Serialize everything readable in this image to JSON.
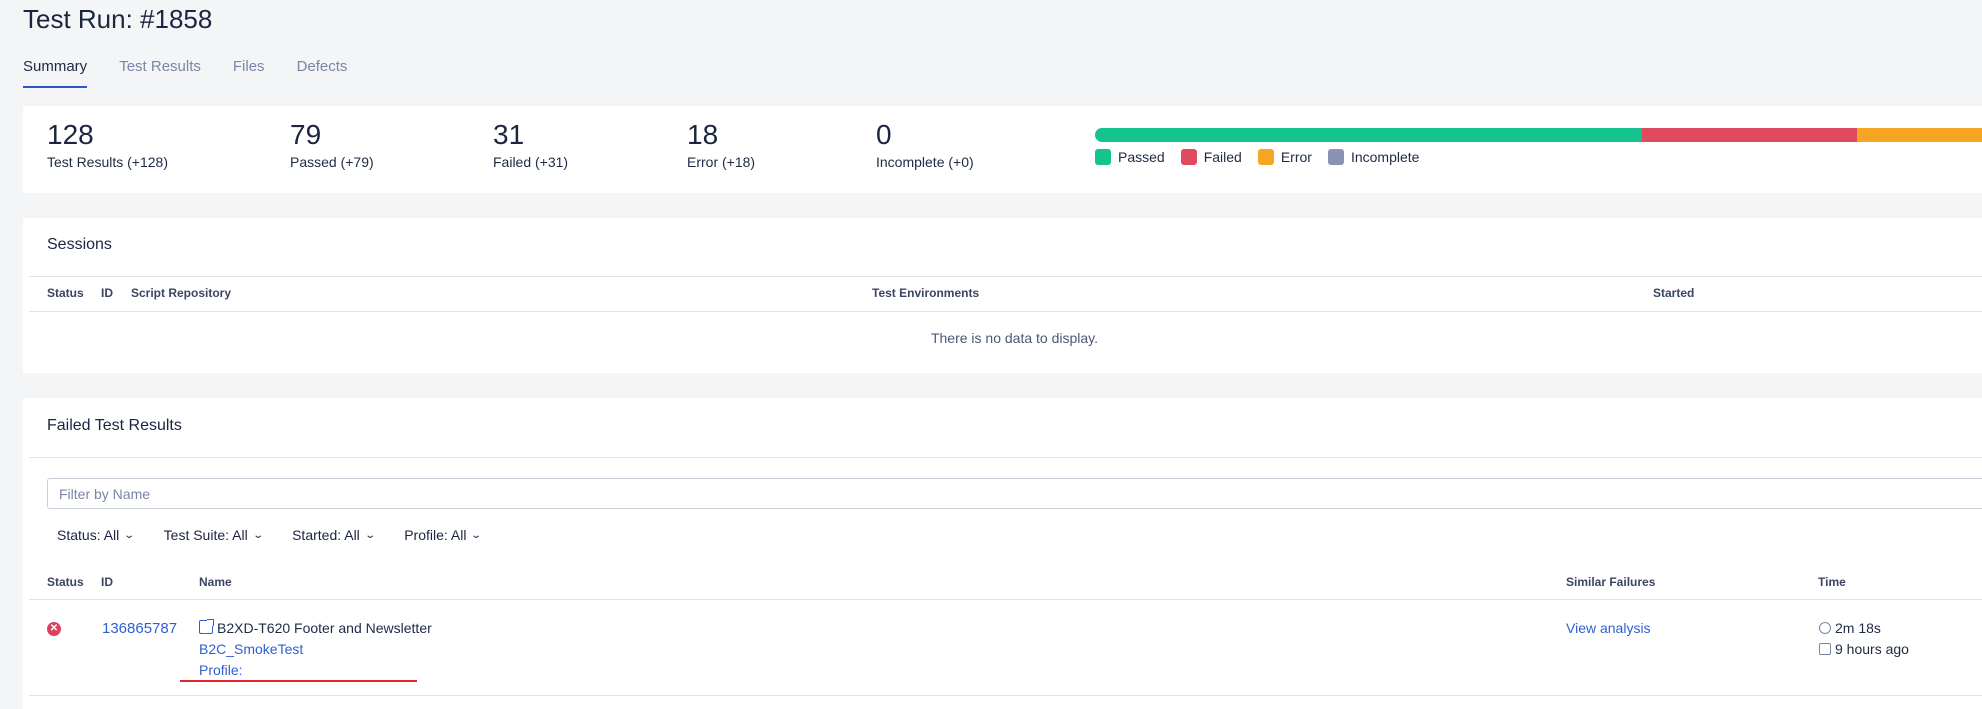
{
  "page": {
    "title": "Test Run: #1858"
  },
  "tabs": [
    "Summary",
    "Test Results",
    "Files",
    "Defects"
  ],
  "summary": {
    "stats": [
      {
        "value": "128",
        "label": "Test Results (+128)"
      },
      {
        "value": "79",
        "label": "Passed (+79)"
      },
      {
        "value": "31",
        "label": "Failed (+31)"
      },
      {
        "value": "18",
        "label": "Error (+18)"
      },
      {
        "value": "0",
        "label": "Incomplete (+0)"
      }
    ],
    "legend": [
      {
        "label": "Passed",
        "color": "#14c38e"
      },
      {
        "label": "Failed",
        "color": "#e04a5f"
      },
      {
        "label": "Error",
        "color": "#f6a623"
      },
      {
        "label": "Incomplete",
        "color": "#8a93b2"
      }
    ],
    "bar_fractions": {
      "passed": 0.6172,
      "failed": 0.2422,
      "error": 0.1406,
      "incomplete": 0.0
    }
  },
  "sessions": {
    "title": "Sessions",
    "columns": [
      "Status",
      "ID",
      "Script Repository",
      "Test Environments",
      "Started"
    ],
    "empty_text": "There is no data to display."
  },
  "failed_results": {
    "title": "Failed Test Results",
    "filter_placeholder": "Filter by Name",
    "filters": [
      "Status: All",
      "Test Suite: All",
      "Started: All",
      "Profile: All"
    ],
    "columns": [
      "Status",
      "ID",
      "Name",
      "Similar Failures",
      "Time"
    ],
    "rows": [
      {
        "id": "136865787",
        "name": "B2XD-T620 Footer and Newsletter",
        "suite": "B2C_SmokeTest",
        "profile": "Profile:",
        "similar": "View analysis",
        "duration": "2m 18s",
        "started": "9 hours ago"
      }
    ]
  }
}
